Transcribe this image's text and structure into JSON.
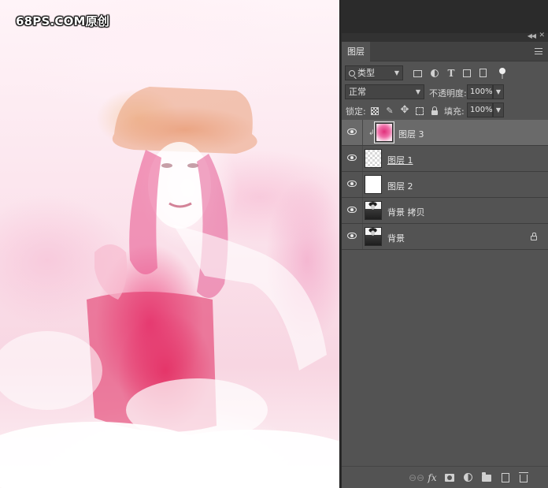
{
  "canvas": {
    "watermark": "68PS.COM原创"
  },
  "panel": {
    "tab_label": "图层",
    "filter": {
      "kind_label": "类型",
      "icons": [
        "image-filter-icon",
        "adjustment-filter-icon",
        "type-filter-icon",
        "shape-filter-icon",
        "smart-object-filter-icon",
        "filter-toggle-icon"
      ]
    },
    "blend": {
      "mode": "正常",
      "opacity_label": "不透明度:",
      "opacity_value": "100%"
    },
    "lock": {
      "label": "锁定:",
      "icons": [
        "lock-transparent-icon",
        "lock-image-icon",
        "lock-position-icon",
        "lock-artboard-icon",
        "lock-all-icon"
      ],
      "fill_label": "填充:",
      "fill_value": "100%"
    },
    "layers": [
      {
        "name": "图层 3",
        "thumb": "pink",
        "selected": true,
        "clipped": true
      },
      {
        "name": "图层 1",
        "thumb": "transparent",
        "selected": false,
        "underlined": true
      },
      {
        "name": "图层 2",
        "thumb": "white",
        "selected": false
      },
      {
        "name": "背景 拷贝",
        "thumb": "photo",
        "selected": false
      },
      {
        "name": "背景",
        "thumb": "photo",
        "selected": false,
        "locked": true
      }
    ],
    "bottom_icons": [
      "link-layers-icon",
      "fx-icon",
      "add-mask-icon",
      "new-adjustment-icon",
      "new-group-icon",
      "new-layer-icon",
      "delete-layer-icon"
    ]
  },
  "colors": {
    "panel_bg": "#535353",
    "selected_row": "#6a6a6a",
    "app_bg": "#2b2b2b"
  }
}
